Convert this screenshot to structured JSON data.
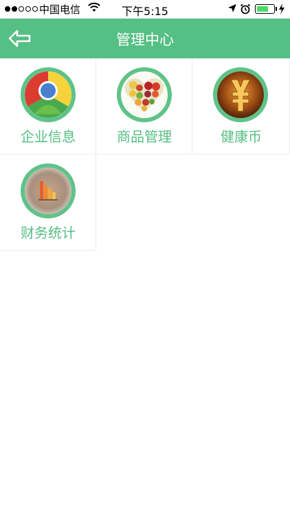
{
  "status_bar": {
    "carrier": "中国电信",
    "time": "下午5:15",
    "battery_level": 0.7
  },
  "nav": {
    "title": "管理中心",
    "back_icon": "back-arrow-icon"
  },
  "menu": {
    "items": [
      {
        "label": "企业信息",
        "icon": "enterprise-info-icon"
      },
      {
        "label": "商品管理",
        "icon": "product-management-icon"
      },
      {
        "label": "健康币",
        "icon": "health-coin-icon"
      },
      {
        "label": "财务统计",
        "icon": "financial-stats-icon"
      }
    ]
  },
  "colors": {
    "accent": "#55bf84",
    "ring": "#5fc389",
    "divider": "#ececec"
  }
}
